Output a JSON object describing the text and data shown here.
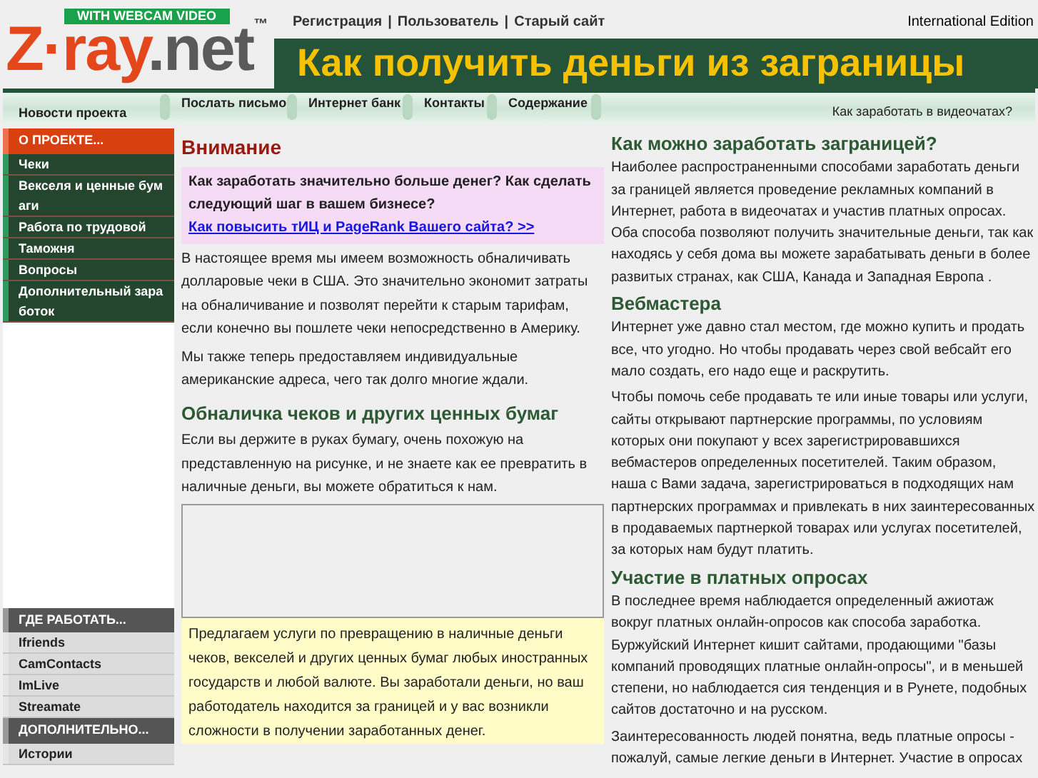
{
  "logo": {
    "badge": "WITH WEBCAM VIDEO",
    "parts": [
      {
        "text": "Z·ray",
        "color": "#e4471c"
      },
      {
        "text": ".net",
        "color": "#5a5a5a"
      }
    ],
    "mark": "™"
  },
  "top_links": [
    "Регистрация",
    "Пользователь",
    "Старый сайт"
  ],
  "top_separator": "|",
  "edition": "International Edition",
  "banner": "Как получить деньги из заграницы",
  "nav": {
    "items": [
      "Новости проекта",
      "Послать письмо",
      "Интернет банк",
      "Контакты",
      "Содержание"
    ],
    "right": "Как заработать в видеочатах?"
  },
  "sidebar": [
    {
      "heading": "О ПРОЕКТЕ...",
      "kind": "dark",
      "items": [
        "Чеки",
        "Векселя и ценные бумаги",
        "Работа по трудовой",
        "Таможня",
        "Вопросы",
        "Дополнительный заработок"
      ]
    },
    {
      "heading": "ГДЕ РАБОТАТЬ...",
      "kind": "light",
      "items": [
        "Ifriends",
        "CamContacts",
        "ImLive",
        "Streamate"
      ]
    },
    {
      "heading": "ДОПОЛНИТЕЛЬНО...",
      "kind": "light",
      "items": [
        "Истории"
      ]
    }
  ],
  "middle": {
    "title": "Внимание",
    "notice": {
      "text": "Как заработать значительно больше денег? Как сделать следующий шаг в вашем бизнесе?",
      "link": "Как повысить тИЦ и PageRank Вашего сайта? >>"
    },
    "paragraphs": [
      "В настоящее время мы имеем возможность обналичивать долларовые чеки в США. Это значительно экономит затраты на обналичивание и позволят перейти к старым тарифам, если конечно вы пошлете чеки непосредственно в Америку.",
      "Мы также теперь предоставляем индивидуальные американские адреса, чего так долго многие ждали."
    ],
    "heading": "Обналичка чеков и других ценных бумаг",
    "intro": "Если вы держите в руках бумагу, очень похожую на представленную на рисунке, и не знаете как ее превратить в наличные деньги, вы можете обратиться к нам.",
    "caption": "Предлагаем услуги по превращению в наличные деньги чеков, векселей и других ценных бумаг любых иностранных государств и любой валюте. Вы заработали деньги, но ваш работодатель находится за границей и у вас возникли сложности в получении заработанных денег."
  },
  "right": [
    {
      "heading": "Как можно заработать заграницей?",
      "paragraphs": [
        "Наиболее распространенными способами заработать деньги за границей является проведение рекламных компаний в Интернет, работа в видеочатах и участив платных опросах. Оба способа позволяют получить значительные деньги, так как находясь у себя дома вы можете зарабатывать деньги в более развитых странах, как США, Канада и Западная Европа ."
      ]
    },
    {
      "heading": "Вебмастера",
      "paragraphs": [
        "Интернет уже давно стал местом, где можно купить и продать все, что угодно. Но чтобы продавать через свой вебсайт его мало создать, его надо еще и раскрутить.",
        "Чтобы помочь себе продавать те или иные товары или услуги, сайты открывают партнерские программы, по условиям которых они покупают у всех зарегистрировавшихся вебмастеров определенных посетителей. Таким образом, наша с Вами задача, зарегистрироваться в подходящих нам партнерских программах и привлекать в них заинтересованных в продаваемых партнеркой товарах или услугах посетителей, за которых нам будут платить."
      ]
    },
    {
      "heading": "Участие в платных опросах",
      "paragraphs": [
        "В последнее время наблюдается определенный ажиотаж вокруг платных онлайн-опросов как способа заработка. Буржуйский Интернет кишит сайтами, продающими \"базы компаний проводящих платные онлайн-опросы\", и в меньшей степени, но наблюдается сия тенденция и в Рунете, подобных сайтов достаточно и на русском.",
        "Заинтересованность людей понятна, ведь платные опросы - пожалуй, самые легкие деньги в Интернет. Участие в опросах"
      ]
    }
  ]
}
